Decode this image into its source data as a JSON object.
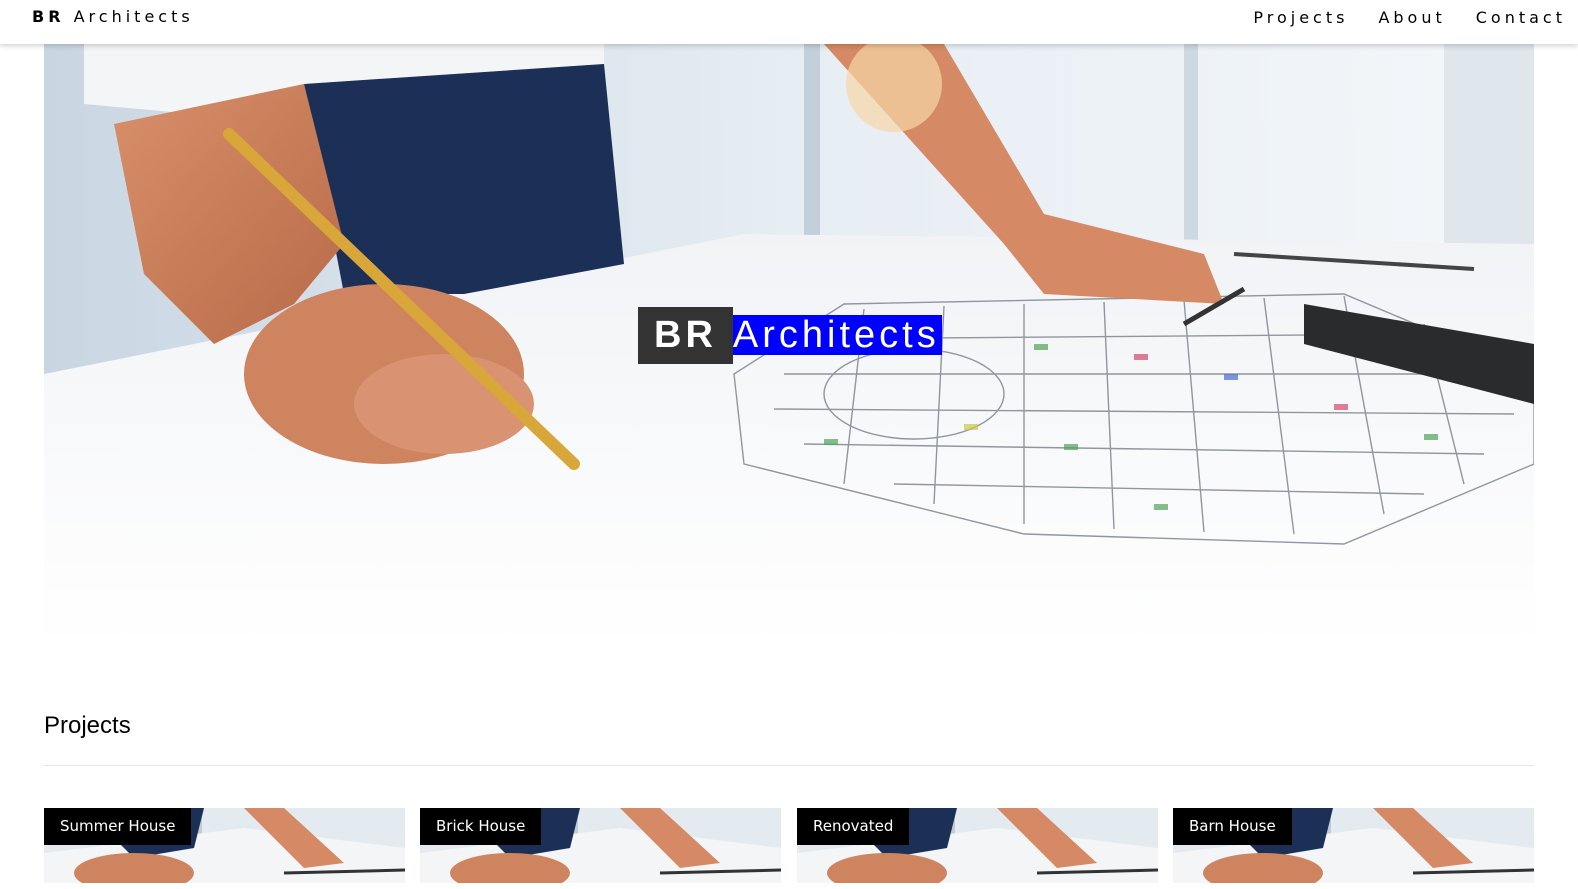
{
  "nav": {
    "brand_bold": "BR",
    "brand_rest": "Architects",
    "links": [
      "Projects",
      "About",
      "Contact"
    ]
  },
  "hero": {
    "title_bold": "BR",
    "title_rest": "Architects",
    "image": "architect-drawing-blueprint-photo"
  },
  "projects": {
    "heading": "Projects",
    "cards": [
      {
        "label": "Summer House"
      },
      {
        "label": "Brick House"
      },
      {
        "label": "Renovated"
      },
      {
        "label": "Barn House"
      }
    ]
  },
  "colors": {
    "selection_highlight": "#0000ff",
    "hero_badge_bg": "#333333",
    "card_label_bg": "#000000"
  }
}
